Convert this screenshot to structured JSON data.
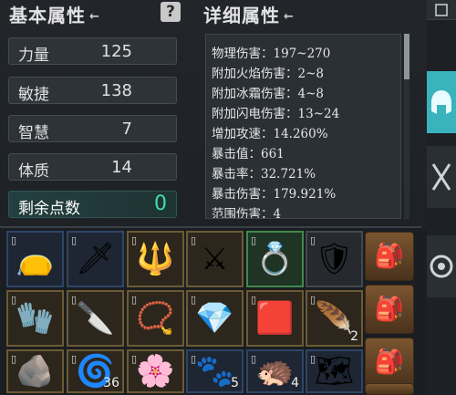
{
  "basic": {
    "title": "基本属性",
    "title_arrow": "←",
    "help_label": "?",
    "stats": [
      {
        "label": "力量",
        "value": "125"
      },
      {
        "label": "敏捷",
        "value": "138"
      },
      {
        "label": "智慧",
        "value": "7"
      },
      {
        "label": "体质",
        "value": "14"
      }
    ],
    "remaining": {
      "label": "剩余点数",
      "value": "0"
    }
  },
  "detail": {
    "title": "详细属性",
    "title_arrow": "←",
    "lines": [
      "物理伤害：197~270",
      "附加火焰伤害：2~8",
      "附加冰霜伤害：4~8",
      "附加闪电伤害：13~24",
      "增加攻速：14.260%",
      "暴击值：661",
      "暴击率：32.721%",
      "暴击伤害：179.921%",
      "范围伤害：4"
    ]
  },
  "sidebar": {
    "top_icon": "close-icon",
    "tabs": [
      "helmet-icon",
      "crossed-swords-icon",
      "settings-icon"
    ]
  },
  "inventory": {
    "rows": [
      [
        {
          "icon": "pouch-icon",
          "glyph": "👝",
          "frame": "blue",
          "count": ""
        },
        {
          "icon": "spear-icon",
          "glyph": "🗡",
          "frame": "blue",
          "count": ""
        },
        {
          "icon": "staff-icon",
          "glyph": "🔱",
          "frame": "gold",
          "count": ""
        },
        {
          "icon": "claw-weapon-icon",
          "glyph": "⚔",
          "frame": "gold",
          "count": ""
        },
        {
          "icon": "ring-icon",
          "glyph": "💍",
          "frame": "green",
          "count": ""
        },
        {
          "icon": "armor-icon",
          "glyph": "🛡",
          "frame": "gray",
          "count": ""
        }
      ],
      [
        {
          "icon": "gauntlet-icon",
          "glyph": "🧤",
          "frame": "gold",
          "count": ""
        },
        {
          "icon": "dagger-icon",
          "glyph": "🔪",
          "frame": "gold",
          "count": ""
        },
        {
          "icon": "amulet-icon",
          "glyph": "📿",
          "frame": "gold",
          "count": ""
        },
        {
          "icon": "gem-icon",
          "glyph": "💎",
          "frame": "gold",
          "count": ""
        },
        {
          "icon": "red-scale-icon",
          "glyph": "🟥",
          "frame": "gold",
          "count": ""
        },
        {
          "icon": "feather-icon",
          "glyph": "🪶",
          "frame": "gold",
          "count": "2"
        }
      ],
      [
        {
          "icon": "ore-icon",
          "glyph": "🪨",
          "frame": "gold",
          "count": ""
        },
        {
          "icon": "scroll-disc-icon",
          "glyph": "🌀",
          "frame": "gold",
          "count": "36"
        },
        {
          "icon": "flower-icon",
          "glyph": "🌸",
          "frame": "gold",
          "count": ""
        },
        {
          "icon": "fur-icon",
          "glyph": "🐾",
          "frame": "blue",
          "count": "5"
        },
        {
          "icon": "hide-icon",
          "glyph": "🦔",
          "frame": "blue",
          "count": "4"
        },
        {
          "icon": "map-icon",
          "glyph": "🗺",
          "frame": "blue",
          "count": ""
        }
      ]
    ],
    "bags": [
      "bag-icon",
      "bag-icon",
      "bag-icon",
      "bag-icon"
    ]
  }
}
